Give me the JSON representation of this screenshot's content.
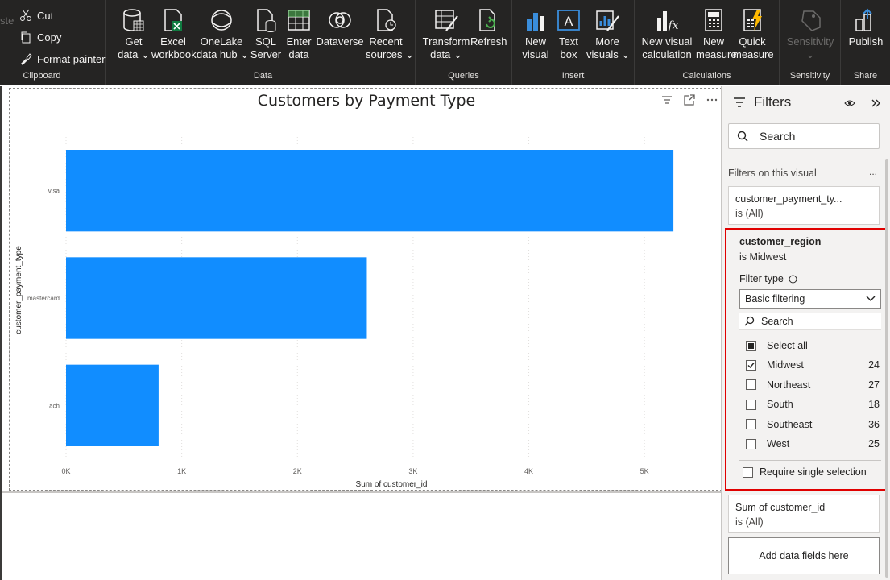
{
  "ribbon": {
    "clipboard": {
      "cut": "Cut",
      "copy": "Copy",
      "format_painter": "Format painter",
      "paste_partial": "ste",
      "group": "Clipboard"
    },
    "data": {
      "get_data": [
        "Get",
        "data ⌄"
      ],
      "excel": [
        "Excel",
        "workbook"
      ],
      "onelake": [
        "OneLake",
        "data hub ⌄"
      ],
      "sql": [
        "SQL",
        "Server"
      ],
      "enter_data": [
        "Enter",
        "data"
      ],
      "dataverse": [
        "Dataverse",
        ""
      ],
      "recent": [
        "Recent",
        "sources ⌄"
      ],
      "group": "Data"
    },
    "queries": {
      "transform": [
        "Transform",
        "data ⌄"
      ],
      "refresh": [
        "Refresh",
        ""
      ],
      "group": "Queries"
    },
    "insert": {
      "new_visual": [
        "New",
        "visual"
      ],
      "text_box": [
        "Text",
        "box"
      ],
      "more_visuals": [
        "More",
        "visuals ⌄"
      ],
      "group": "Insert"
    },
    "calculations": {
      "new_visual_calc": [
        "New visual",
        "calculation"
      ],
      "new_measure": [
        "New",
        "measure"
      ],
      "quick_measure": [
        "Quick",
        "measure"
      ],
      "group": "Calculations"
    },
    "sensitivity": {
      "label": [
        "Sensitivity",
        "⌄"
      ],
      "group": "Sensitivity"
    },
    "share": {
      "publish": [
        "Publish",
        ""
      ],
      "group": "Share"
    }
  },
  "chart_data": {
    "type": "bar",
    "orientation": "horizontal",
    "title": "Customers by Payment Type",
    "xlabel": "Sum of customer_id",
    "ylabel": "customer_payment_type",
    "categories": [
      "visa",
      "mastercard",
      "ach"
    ],
    "values": [
      5250,
      2600,
      800
    ],
    "xlim": [
      0,
      5500
    ],
    "xticks": [
      0,
      1000,
      2000,
      3000,
      4000,
      5000
    ],
    "xtick_labels": [
      "0K",
      "1K",
      "2K",
      "3K",
      "4K",
      "5K"
    ],
    "bar_color": "#118dff",
    "grid": "vertical-dotted"
  },
  "filters": {
    "title": "Filters",
    "search_placeholder": "Search",
    "section_label": "Filters on this visual",
    "section_more": "...",
    "card_payment": {
      "field": "customer_payment_ty...",
      "state": "is (All)"
    },
    "card_region": {
      "field": "customer_region",
      "state": "is Midwest",
      "filter_type_label": "Filter type",
      "filter_type_value": "Basic filtering",
      "search": "Search",
      "select_all": "Select all",
      "options": [
        {
          "label": "Midwest",
          "count": "24",
          "checked": true
        },
        {
          "label": "Northeast",
          "count": "27",
          "checked": false
        },
        {
          "label": "South",
          "count": "18",
          "checked": false
        },
        {
          "label": "Southeast",
          "count": "36",
          "checked": false
        },
        {
          "label": "West",
          "count": "25",
          "checked": false
        }
      ],
      "require_single": "Require single selection"
    },
    "card_sum": {
      "field": "Sum of customer_id",
      "state": "is (All)"
    },
    "add_fields": "Add data fields here"
  }
}
